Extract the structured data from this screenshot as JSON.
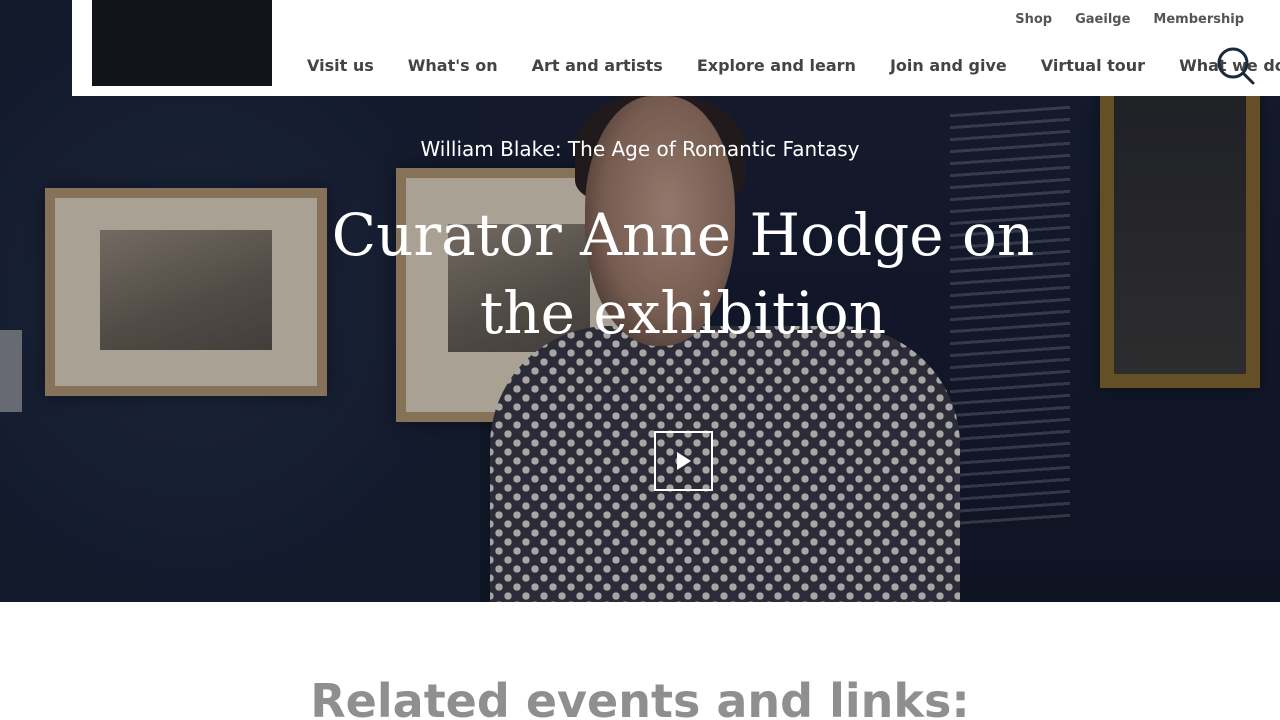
{
  "utility_nav": {
    "items": [
      {
        "label": "Shop"
      },
      {
        "label": "Gaeilge"
      },
      {
        "label": "Membership"
      }
    ]
  },
  "main_nav": {
    "items": [
      {
        "label": "Visit us"
      },
      {
        "label": "What's on"
      },
      {
        "label": "Art and artists"
      },
      {
        "label": "Explore and learn"
      },
      {
        "label": "Join and give"
      },
      {
        "label": "Virtual tour"
      },
      {
        "label": "What we do"
      }
    ]
  },
  "icons": {
    "search": "search-icon",
    "play": "play-icon"
  },
  "hero": {
    "eyebrow": "William Blake: The Age of Romantic Fantasy",
    "title": "Curator Anne Hodge on the exhibition"
  },
  "related": {
    "heading": "Related events and links:"
  },
  "colors": {
    "header_bg": "#ffffff",
    "logo": "#12141c",
    "nav_text": "#444444",
    "hero_text": "#ffffff",
    "heading_grey": "#8f8f8f",
    "search_icon": "#1a2a3a"
  }
}
